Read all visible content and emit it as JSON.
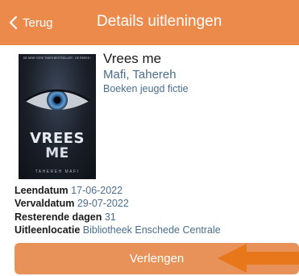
{
  "nav": {
    "back_label": "Terug",
    "title": "Details uitleningen",
    "color": "#ec8a4c"
  },
  "book": {
    "title": "Vrees me",
    "author": "Mafi,  Tahereh",
    "category": "Boeken jeugd fictie",
    "cover": {
      "top_line": "DE NEW YORK TIMES BESTSELLER  ·  DE REEKS SHATTER ME",
      "title_line_1": "VREES",
      "title_line_2": "ME",
      "author": "TAHEREH MAFI"
    }
  },
  "details": {
    "loan_date_label": "Leendatum",
    "loan_date": "17-06-2022",
    "due_date_label": "Vervaldatum",
    "due_date": "29-07-2022",
    "days_left_label": "Resterende dagen",
    "days_left": "31",
    "location_label": "Uitleenlocatie",
    "location": "Bibliotheek Enschede Centrale"
  },
  "actions": {
    "renew_label": "Verlengen",
    "button_color": "#e8925a",
    "arrow_color": "#e8761a"
  },
  "icons": {
    "back": "chevron-left-icon",
    "pointer": "arrow-left-icon"
  }
}
